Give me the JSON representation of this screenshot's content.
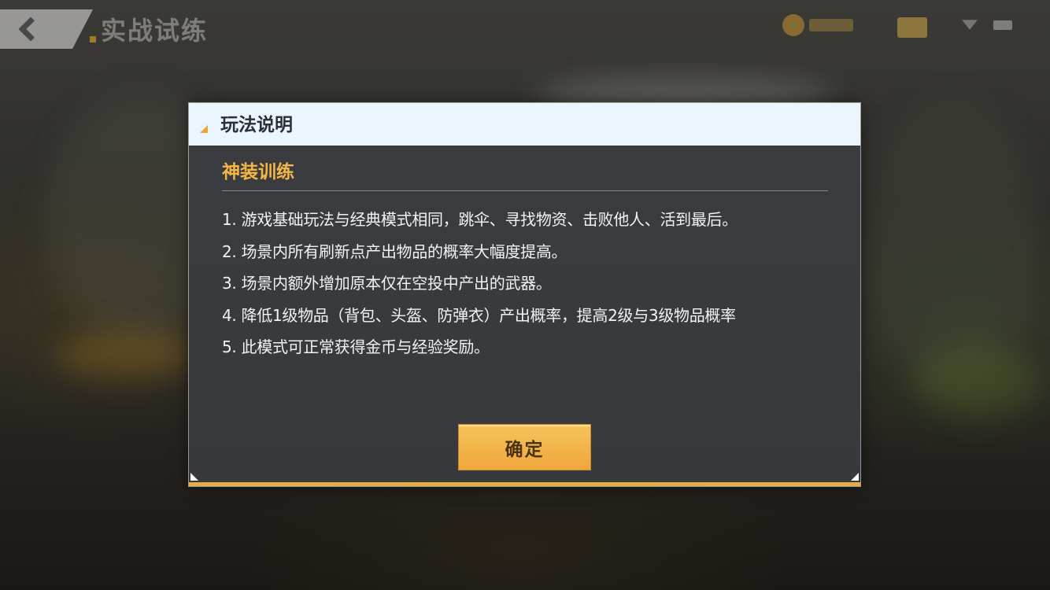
{
  "top_bar": {
    "title": "实战试练"
  },
  "dialog": {
    "title": "玩法说明",
    "section_title": "神装训练",
    "rules": [
      "1. 游戏基础玩法与经典模式相同，跳伞、寻找物资、击败他人、活到最后。",
      "2. 场景内所有刷新点产出物品的概率大幅度提高。",
      "3. 场景内额外增加原本仅在空投中产出的武器。",
      "4. 降低1级物品（背包、头盔、防弹衣）产出概率，提高2级与3级物品概率",
      "5. 此模式可正常获得金币与经验奖励。"
    ],
    "confirm_label": "确定"
  },
  "colors": {
    "accent_orange": "#f5b646",
    "header_bg": "#eaf5fd",
    "dialog_bg": "#3a3c40",
    "button_bg": "#efa73c"
  },
  "icons": [
    "back-icon",
    "coin-icon",
    "mail-icon",
    "wifi-icon",
    "battery-icon"
  ]
}
